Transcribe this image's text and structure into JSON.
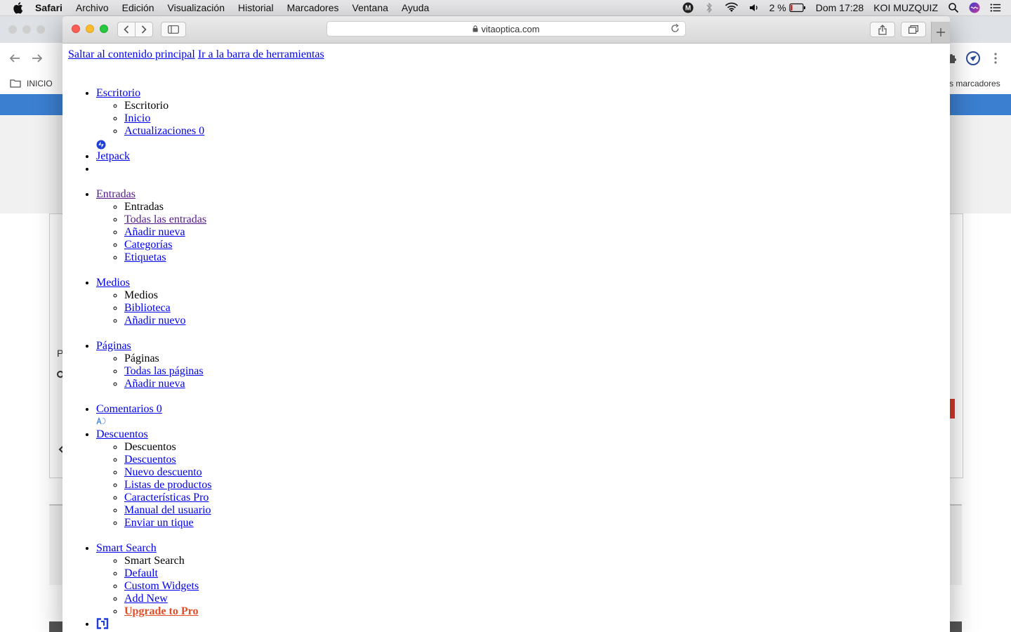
{
  "menubar": {
    "items": [
      "Safari",
      "Archivo",
      "Edición",
      "Visualización",
      "Historial",
      "Marcadores",
      "Ventana",
      "Ayuda"
    ],
    "battery": "2 %",
    "clock": "Dom 17:28",
    "user": "KOI MUZQUIZ"
  },
  "bg_browser": {
    "bookmark_inicio": "INICIO",
    "bookmark_marcadores": "s marcadores",
    "stray_letter": "P"
  },
  "safari": {
    "address": "vitaoptica.com"
  },
  "page": {
    "skip_main": "Saltar al contenido principal",
    "skip_toolbar": "Ir a la barra de herramientas",
    "menu": [
      {
        "label": "Escritorio",
        "sub_title": "Escritorio",
        "sub": [
          "Inicio",
          "Actualizaciones 0"
        ]
      },
      {
        "label": "Jetpack"
      },
      {
        "label": ""
      },
      {
        "label": "Entradas",
        "sub_title": "Entradas",
        "sub": [
          "Todas las entradas",
          "Añadir nueva",
          "Categorías",
          "Etiquetas"
        ]
      },
      {
        "label": "Medios",
        "sub_title": "Medios",
        "sub": [
          "Biblioteca",
          "Añadir nuevo"
        ]
      },
      {
        "label": "Páginas",
        "sub_title": "Páginas",
        "sub": [
          "Todas las páginas",
          "Añadir nueva"
        ]
      },
      {
        "label": "Comentarios 0"
      },
      {
        "label": "Descuentos",
        "sub_title": "Descuentos",
        "sub": [
          "Descuentos",
          "Nuevo descuento",
          "Listas de productos",
          "Características Pro",
          "Manual del usuario",
          "Enviar un tique"
        ]
      },
      {
        "label": "Smart Search",
        "sub_title": "Smart Search",
        "sub": [
          "Default",
          "Custom Widgets",
          "Add New",
          "Upgrade to Pro"
        ]
      }
    ]
  },
  "colors": {
    "link": "#0000ee",
    "visited": "#551a8b",
    "upgrade": "#e34c26",
    "bg_bluebar": "#3b7fd1"
  }
}
